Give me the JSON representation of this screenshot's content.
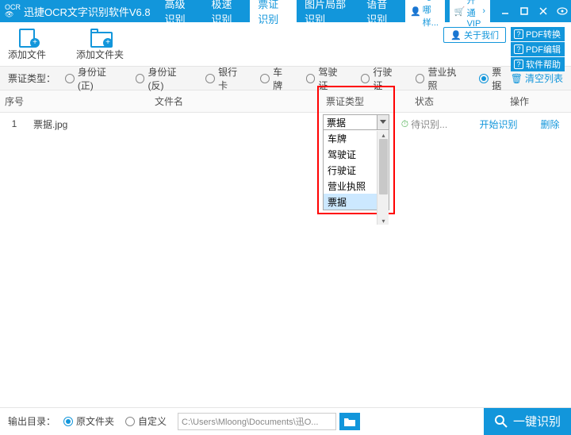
{
  "titlebar": {
    "logo_top": "OCR",
    "app_title": "迅捷OCR文字识别软件V6.8",
    "tabs": [
      "高级识别",
      "极速识别",
      "票证识别",
      "图片局部识别",
      "语音识别"
    ],
    "active_tab": 2,
    "user_label": "^o^哪样...",
    "vip_label": "开通VIP"
  },
  "toolbar": {
    "add_file": "添加文件",
    "add_folder": "添加文件夹",
    "about": "关于我们",
    "side_links": [
      "PDF转换",
      "PDF编辑",
      "软件帮助"
    ]
  },
  "filter": {
    "label": "票证类型：",
    "options": [
      "身份证(正)",
      "身份证(反)",
      "银行卡",
      "车牌",
      "驾驶证",
      "行驶证",
      "营业执照",
      "票据"
    ],
    "selected": 7,
    "clear": "清空列表"
  },
  "table": {
    "headers": {
      "idx": "序号",
      "file": "文件名",
      "type": "票证类型",
      "status": "状态",
      "op": "操作"
    },
    "rows": [
      {
        "idx": "1",
        "file": "票据.jpg",
        "status": "待识别...",
        "op_start": "开始识别",
        "op_del": "删除"
      }
    ]
  },
  "dropdown": {
    "selected": "票据",
    "items": [
      "车牌",
      "驾驶证",
      "行驶证",
      "营业执照",
      "票据"
    ],
    "highlighted": 4
  },
  "footer": {
    "label": "输出目录：",
    "opt_original": "原文件夹",
    "opt_custom": "自定义",
    "selected": 0,
    "path": "C:\\Users\\Mloong\\Documents\\迅O...",
    "recognize": "一键识别"
  }
}
